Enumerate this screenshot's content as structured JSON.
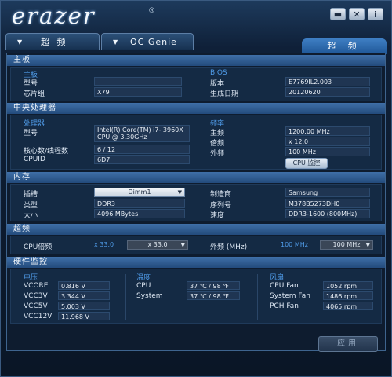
{
  "titlebar": {
    "logo": "erazer",
    "reg": "®",
    "min": "▬",
    "close": "✕",
    "info": "i"
  },
  "tabs": {
    "tab1": "超 频",
    "tab2": "OC Genie",
    "active": "超 频",
    "arrow": "▼"
  },
  "motherboard": {
    "section": "主板",
    "sub_board": "主板",
    "model_label": "型号",
    "model_value": "",
    "chipset_label": "芯片组",
    "chipset_value": "X79",
    "sub_bios": "BIOS",
    "bios_version_label": "版本",
    "bios_version_value": "E7769IL2.003",
    "bios_date_label": "生成日期",
    "bios_date_value": "20120620"
  },
  "cpu": {
    "section": "中央处理器",
    "sub_processor": "处理器",
    "model_label": "型号",
    "model_value": "Intel(R) Core(TM) i7- 3960X CPU @ 3.30GHz",
    "cores_label": "核心数/线程数",
    "cores_value": "6 / 12",
    "cpuid_label": "CPUID",
    "cpuid_value": "6D7",
    "sub_freq": "频率",
    "freq_label": "主频",
    "freq_value": "1200.00 MHz",
    "mult_label": "倍频",
    "mult_value": "x 12.0",
    "ext_label": "外频",
    "ext_value": "100 MHz",
    "monitor_button": "CPU 监控"
  },
  "memory": {
    "section": "内存",
    "slot_label": "插槽",
    "slot_value": "Dimm1",
    "type_label": "类型",
    "type_value": "DDR3",
    "size_label": "大小",
    "size_value": "4096 MBytes",
    "maker_label": "制造商",
    "maker_value": "Samsung",
    "serial_label": "序列号",
    "serial_value": "M378B5273DH0",
    "speed_label": "速度",
    "speed_value": "DDR3-1600 (800MHz)"
  },
  "overclock": {
    "section": "超频",
    "cpu_mult_label": "CPU倍频",
    "cpu_mult_current": "x 33.0",
    "cpu_mult_select": "x 33.0",
    "ext_label": "外频 (MHz)",
    "ext_current": "100 MHz",
    "ext_select": "100 MHz"
  },
  "hwmon": {
    "section": "硬件监控",
    "volt_title": "电压",
    "volts": [
      {
        "label": "VCORE",
        "value": "0.816 V"
      },
      {
        "label": "VCC3V",
        "value": "3.344 V"
      },
      {
        "label": "VCC5V",
        "value": "5.003 V"
      },
      {
        "label": "VCC12V",
        "value": "11.968 V"
      }
    ],
    "temp_title": "温度",
    "temps": [
      {
        "label": "CPU",
        "value": "37 ℃ / 98 ℉"
      },
      {
        "label": "System",
        "value": "37 ℃ / 98 ℉"
      }
    ],
    "fan_title": "风扇",
    "fans": [
      {
        "label": "CPU Fan",
        "value": "1052 rpm"
      },
      {
        "label": "System Fan",
        "value": "1486 rpm"
      },
      {
        "label": "PCH Fan",
        "value": "4065 rpm"
      }
    ]
  },
  "apply_button": "应用",
  "colors": {
    "accent": "#4f9be8",
    "section_bar": "#3f6fa8",
    "background": "#0e1c2f"
  }
}
